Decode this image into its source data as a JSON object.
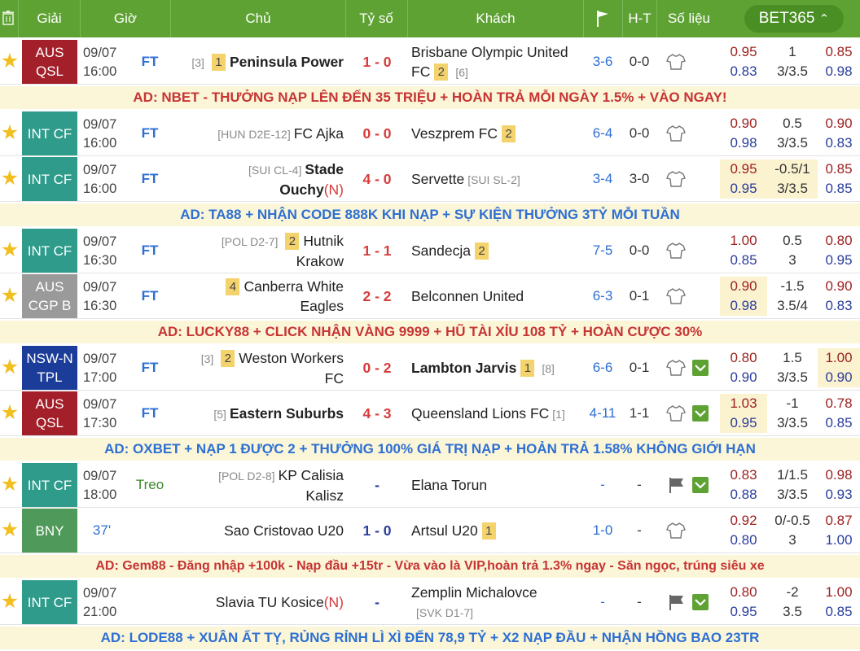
{
  "header": {
    "giai": "Giải",
    "gio": "Giờ",
    "chu": "Chủ",
    "tyso": "Tỷ số",
    "khach": "Khách",
    "ht": "H-T",
    "solieu": "Số liệu",
    "bookmaker": "BET365"
  },
  "colors": {
    "header_green": "#5fa234",
    "aus_league": "#a3202a",
    "int_cf": "#2f9b8b",
    "aus_cgp": "#9a9a9a",
    "nsw": "#1c3c9a",
    "bny": "#4f9a5a",
    "score_red": "#d83a3a",
    "link_blue": "#2e6fd3",
    "ad_red": "#c73434",
    "ad_blue": "#2e6fd3"
  },
  "ads": [
    {
      "text": "AD: NBET - THƯỞNG NẠP LÊN ĐẾN 35 TRIỆU + HOÀN TRẢ MỖI NGÀY 1.5% + VÀO NGAY!"
    },
    {
      "text": "AD: TA88 + NHẬN CODE 888K KHI NẠP + SỰ KIỆN THƯỞNG 3TỶ MỖI TUẦN"
    },
    {
      "text": "AD: LUCKY88 + CLICK NHẬN VÀNG 9999 + HŨ TÀI XỈU 108 TỶ + HOÀN CƯỢC 30%"
    },
    {
      "text": "AD: OXBET + NẠP 1 ĐƯỢC 2 + THƯỞNG 100% GIÁ TRỊ NẠP + HOẢN TRẢ 1.58% KHÔNG GIỚI HẠN"
    },
    {
      "text": "AD: Gem88 - Đăng nhập +100k - Nạp đầu +15tr - Vừa vào là VIP,hoàn trả 1.3% ngay - Săn ngọc, trúng siêu xe"
    },
    {
      "text": "AD: LODE88 + XUÂN ẤT TỴ, RỦNG RỈNH LÌ XÌ ĐẾN 78,9 TỶ + X2 NẠP ĐẦU + NHẬN HỒNG BAO 23TR"
    }
  ],
  "matches": [
    {
      "league1": "AUS",
      "league2": "QSL",
      "date": "09/07",
      "time": "16:00",
      "status": "FT",
      "home_rank": "[3]",
      "home_card": "1",
      "home1": "Peninsula Power",
      "home2": "",
      "score": "1 - 0",
      "away1": "Brisbane Olympic United",
      "away2": "FC",
      "away_card": "2",
      "away_rank": "[6]",
      "corner": "3-6",
      "ht": "0-0",
      "o1": "0.95",
      "o2": "0.83",
      "h1": "1",
      "h2": "3/3.5",
      "a1": "0.85",
      "a2": "0.98"
    },
    {
      "league1": "INT CF",
      "league2": "",
      "date": "09/07",
      "time": "16:00",
      "status": "FT",
      "home_rank": "[HUN D2E-12]",
      "home1": "FC Ajka",
      "score": "0 - 0",
      "away1": "Veszprem FC",
      "away_card": "2",
      "corner": "6-4",
      "ht": "0-0",
      "o1": "0.90",
      "o2": "0.98",
      "h1": "0.5",
      "h2": "3/3.5",
      "a1": "0.90",
      "a2": "0.83"
    },
    {
      "league1": "INT CF",
      "league2": "",
      "date": "09/07",
      "time": "16:00",
      "status": "FT",
      "home_rank": "[SUI CL-4]",
      "home1": "Stade",
      "home2": "Ouchy",
      "home_n": "(N)",
      "score": "4 - 0",
      "away1": "Servette",
      "away_rank": "[SUI SL-2]",
      "corner": "3-4",
      "ht": "3-0",
      "o1": "0.95",
      "o2": "0.95",
      "h1": "-0.5/1",
      "h2": "3/3.5",
      "a1": "0.85",
      "a2": "0.85"
    },
    {
      "league1": "INT CF",
      "league2": "",
      "date": "09/07",
      "time": "16:30",
      "status": "FT",
      "home_rank": "[POL D2-7]",
      "home_card": "2",
      "home1": "Hutnik",
      "home2": "Krakow",
      "score": "1 - 1",
      "away1": "Sandecja",
      "away_card": "2",
      "corner": "7-5",
      "ht": "0-0",
      "o1": "1.00",
      "o2": "0.85",
      "h1": "0.5",
      "h2": "3",
      "a1": "0.80",
      "a2": "0.95"
    },
    {
      "league1": "AUS",
      "league2": "CGP B",
      "date": "09/07",
      "time": "16:30",
      "status": "FT",
      "home_card": "4",
      "home1": "Canberra White",
      "home2": "Eagles",
      "score": "2 - 2",
      "away1": "Belconnen United",
      "corner": "6-3",
      "ht": "0-1",
      "o1": "0.90",
      "o2": "0.98",
      "h1": "-1.5",
      "h2": "3.5/4",
      "a1": "0.90",
      "a2": "0.83"
    },
    {
      "league1": "NSW-N",
      "league2": "TPL",
      "date": "09/07",
      "time": "17:00",
      "status": "FT",
      "home_rank": "[3]",
      "home_card": "2",
      "home1": "Weston Workers",
      "home2": "FC",
      "score": "0 - 2",
      "away1": "Lambton Jarvis",
      "away_card": "1",
      "away_rank": "[8]",
      "corner": "6-6",
      "ht": "0-1",
      "o1": "0.80",
      "o2": "0.90",
      "h1": "1.5",
      "h2": "3/3.5",
      "a1": "1.00",
      "a2": "0.90"
    },
    {
      "league1": "AUS",
      "league2": "QSL",
      "date": "09/07",
      "time": "17:30",
      "status": "FT",
      "home_rank": "[5]",
      "home1": "Eastern Suburbs",
      "score": "4 - 3",
      "away1": "Queensland Lions FC",
      "away_rank": "[1]",
      "corner": "4-11",
      "ht": "1-1",
      "o1": "1.03",
      "o2": "0.95",
      "h1": "-1",
      "h2": "3/3.5",
      "a1": "0.78",
      "a2": "0.85"
    },
    {
      "league1": "INT CF",
      "league2": "",
      "date": "09/07",
      "time": "18:00",
      "status": "Treo",
      "home_rank": "[POL D2-8]",
      "home1": "KP Calisia",
      "home2": "Kalisz",
      "score": "-",
      "away1": "Elana Torun",
      "corner": "-",
      "ht": "-",
      "o1": "0.83",
      "o2": "0.88",
      "h1": "1/1.5",
      "h2": "3/3.5",
      "a1": "0.98",
      "a2": "0.93"
    },
    {
      "league1": "BNY",
      "league2": "",
      "date": "",
      "time": "",
      "status": "37'",
      "home1": "Sao Cristovao U20",
      "score": "1 - 0",
      "away1": "Artsul U20",
      "away_card": "1",
      "corner": "1-0",
      "ht": "-",
      "o1": "0.92",
      "o2": "0.80",
      "h1": "0/-0.5",
      "h2": "3",
      "a1": "0.87",
      "a2": "1.00"
    },
    {
      "league1": "INT CF",
      "league2": "",
      "date": "09/07",
      "time": "21:00",
      "status": "",
      "home1": "Slavia TU Kosice",
      "home_n": "(N)",
      "score": "-",
      "away1": "Zemplin Michalovce",
      "away_rank2": "[SVK D1-7]",
      "corner": "-",
      "ht": "-",
      "o1": "0.80",
      "o2": "0.95",
      "h1": "-2",
      "h2": "3.5",
      "a1": "1.00",
      "a2": "0.85"
    }
  ]
}
